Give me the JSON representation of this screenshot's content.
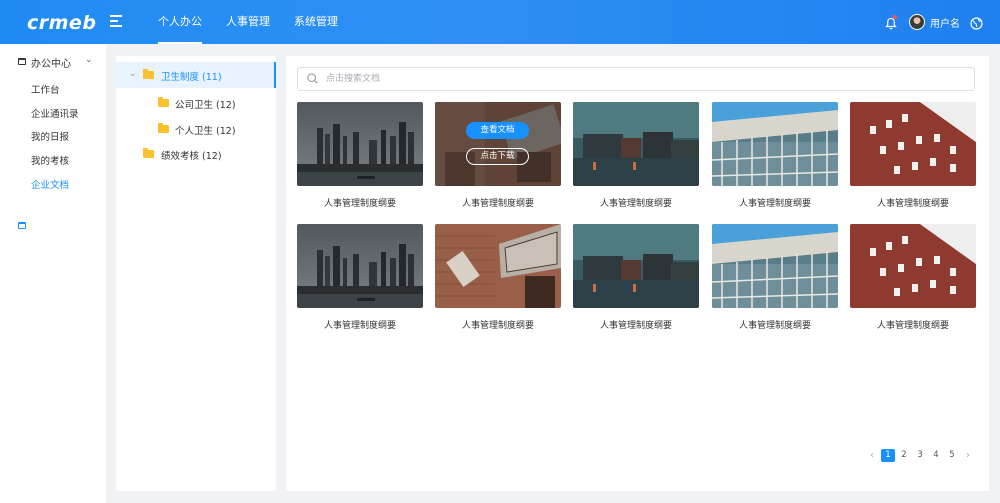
{
  "header": {
    "logo": "crmeb",
    "nav": [
      "个人办公",
      "人事管理",
      "系统管理"
    ],
    "username": "用户名"
  },
  "sidebar": {
    "group_label": "办公中心",
    "items": [
      "工作台",
      "企业通讯录",
      "我的日报",
      "我的考核",
      "企业文档"
    ],
    "active_item": "企业文档"
  },
  "tree": {
    "nodes": [
      {
        "label": "卫生制度 (11)",
        "selected": true
      },
      {
        "label": "公司卫生 (12)"
      },
      {
        "label": "个人卫生 (12)"
      },
      {
        "label": "绩效考核 (12)"
      }
    ]
  },
  "search": {
    "placeholder": "点击搜索文档"
  },
  "documents": [
    {
      "title": "人事管理制度纲要",
      "image": "city-skyline-dusk"
    },
    {
      "title": "人事管理制度纲要",
      "image": "archive-brick-sign"
    },
    {
      "title": "人事管理制度纲要",
      "image": "river-buildings-evening"
    },
    {
      "title": "人事管理制度纲要",
      "image": "glass-facade-blue-sky"
    },
    {
      "title": "人事管理制度纲要",
      "image": "red-brick-building"
    },
    {
      "title": "人事管理制度纲要",
      "image": "city-skyline-dusk"
    },
    {
      "title": "人事管理制度纲要",
      "image": "archive-brick-sign"
    },
    {
      "title": "人事管理制度纲要",
      "image": "river-buildings-evening"
    },
    {
      "title": "人事管理制度纲要",
      "image": "glass-facade-blue-sky"
    },
    {
      "title": "人事管理制度纲要",
      "image": "red-brick-building"
    }
  ],
  "hover_card": {
    "view_label": "查看文档",
    "download_label": "点击下载"
  },
  "pagination": {
    "pages": [
      "1",
      "2",
      "3",
      "4",
      "5"
    ],
    "current": "1"
  },
  "colors": {
    "primary": "#1890ff",
    "header_gradient": "#1f8cf3",
    "folder": "#fbc02d"
  }
}
